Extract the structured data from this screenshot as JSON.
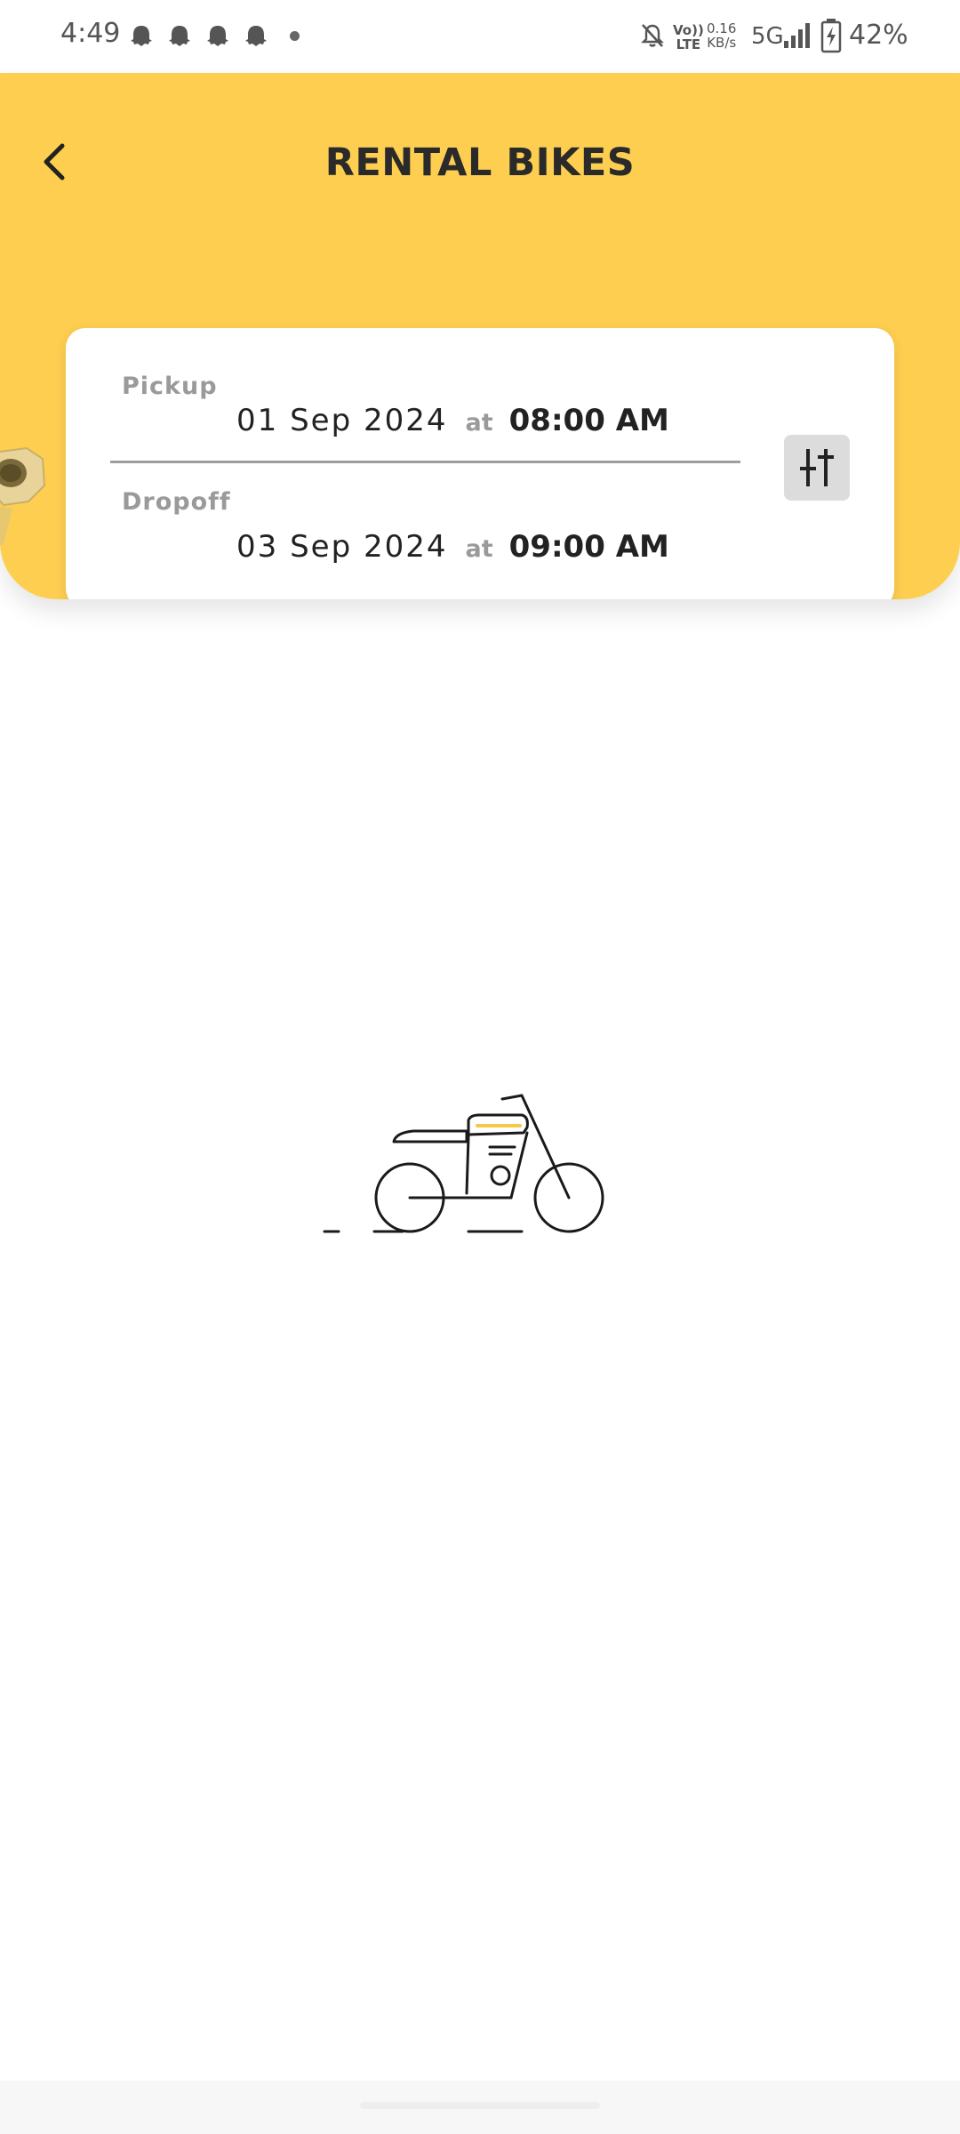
{
  "status_bar": {
    "time": "4:49",
    "network_top": "Vo))",
    "network_bottom": "LTE",
    "speed_value": "0.16",
    "speed_unit": "KB/s",
    "network_type": "5G",
    "battery": "42%"
  },
  "header": {
    "title": "RENTAL BIKES",
    "background_color": "#FDCE50"
  },
  "booking": {
    "pickup": {
      "label": "Pickup",
      "date": "01 Sep 2024",
      "at": "at",
      "time": "08:00 AM"
    },
    "dropoff": {
      "label": "Dropoff",
      "date": "03 Sep 2024",
      "at": "at",
      "time": "09:00 AM"
    }
  },
  "icons": {
    "back": "chevron-left-icon",
    "filter": "sliders-icon",
    "notifications": "ghost-notification-icon",
    "mute": "bell-off-icon",
    "signal": "signal-bars-icon",
    "battery": "battery-charging-icon",
    "illustration": "motorcycle-illustration"
  }
}
